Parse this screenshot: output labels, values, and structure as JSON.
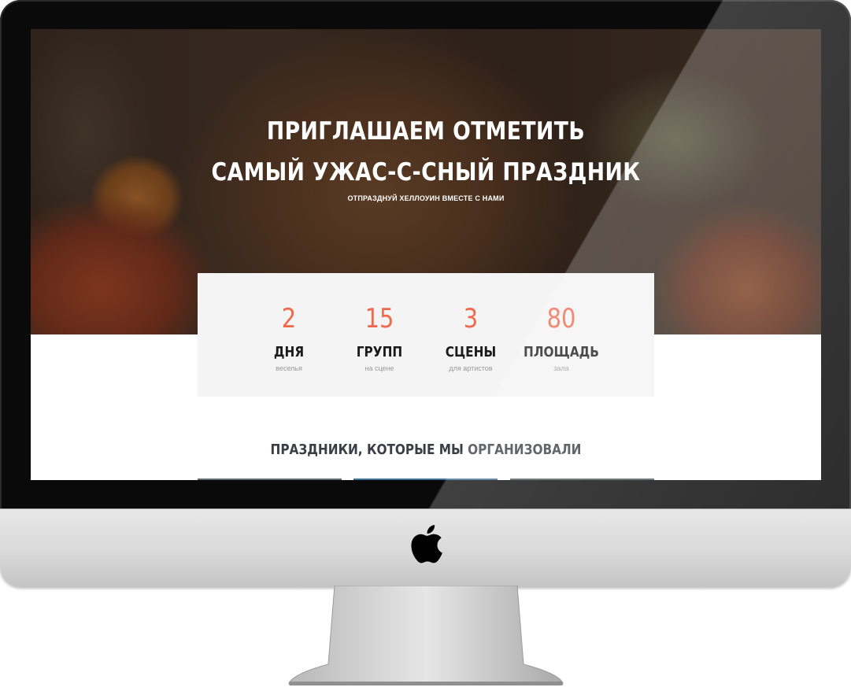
{
  "hero": {
    "title_line1": "ПРИГЛАШАЕМ ОТМЕТИТЬ",
    "title_line2": "САМЫЙ УЖАС-С-СНЫЙ ПРАЗДНИК",
    "subtitle": "ОТПРАЗДНУЙ ХЕЛЛОУИН ВМЕСТЕ С НАМИ"
  },
  "stats": [
    {
      "number": "2",
      "label": "ДНЯ",
      "sub": "веселья"
    },
    {
      "number": "15",
      "label": "ГРУПП",
      "sub": "на сцене"
    },
    {
      "number": "3",
      "label": "СЦЕНЫ",
      "sub": "для артистов"
    },
    {
      "number": "80",
      "label": "ПЛОЩАДЬ",
      "sub": "зала"
    }
  ],
  "section": {
    "title": "ПРАЗДНИКИ, КОТОРЫЕ МЫ ОРГАНИЗОВАЛИ"
  },
  "colors": {
    "accent": "#ef6a4c",
    "card_bg": "#f4f4f4",
    "heading": "#3a3d44"
  },
  "icons": {
    "brand": "apple-logo-icon"
  }
}
